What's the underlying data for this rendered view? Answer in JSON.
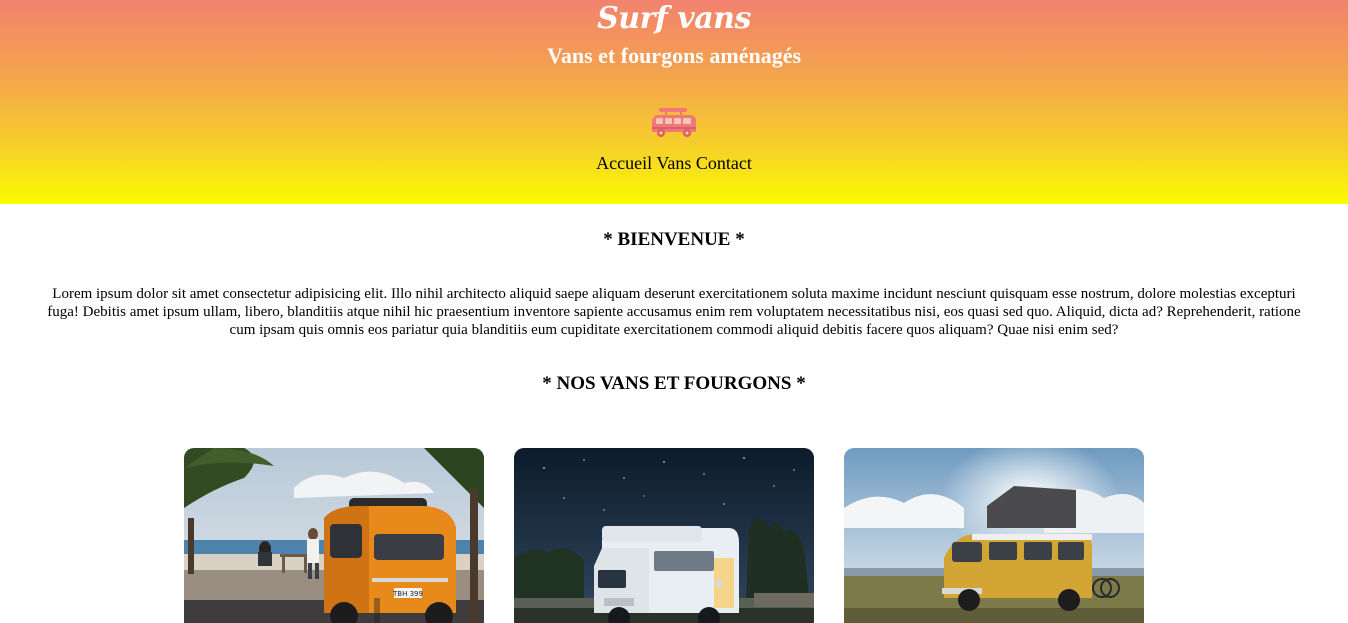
{
  "header": {
    "brand": "Surf vans",
    "subtitle": "Vans et fourgons aménagés",
    "logo_icon": "van-icon",
    "logo_color": "#f0787a"
  },
  "nav": {
    "items": [
      {
        "label": "Accueil"
      },
      {
        "label": "Vans"
      },
      {
        "label": "Contact"
      }
    ]
  },
  "welcome": {
    "title": "* BIENVENUE *",
    "text": "Lorem ipsum dolor sit amet consectetur adipisicing elit. Illo nihil architecto aliquid saepe aliquam deserunt exercitationem soluta maxime incidunt nesciunt quisquam esse nostrum, dolore molestias excepturi fuga! Debitis amet ipsum ullam, libero, blanditiis atque nihil hic praesentium inventore sapiente accusamus enim rem voluptatem necessitatibus nisi, eos quasi sed quo. Aliquid, dicta ad? Reprehenderit, ratione cum ipsam quis omnis eos pariatur quia blanditiis eum cupiditate exercitationem commodi aliquid debitis facere quos aliquam? Quae nisi enim sed?"
  },
  "vans": {
    "title": "* NOS VANS ET FOURGONS *",
    "cards": [
      {
        "image": "orange-vw-van-beach-photo",
        "plate": "TBH 399"
      },
      {
        "image": "white-camper-night-sky-photo"
      },
      {
        "image": "yellow-pop-top-van-field-photo"
      }
    ]
  },
  "colors": {
    "gradient_top": "#f2826f",
    "gradient_bottom": "#fbfb02"
  }
}
